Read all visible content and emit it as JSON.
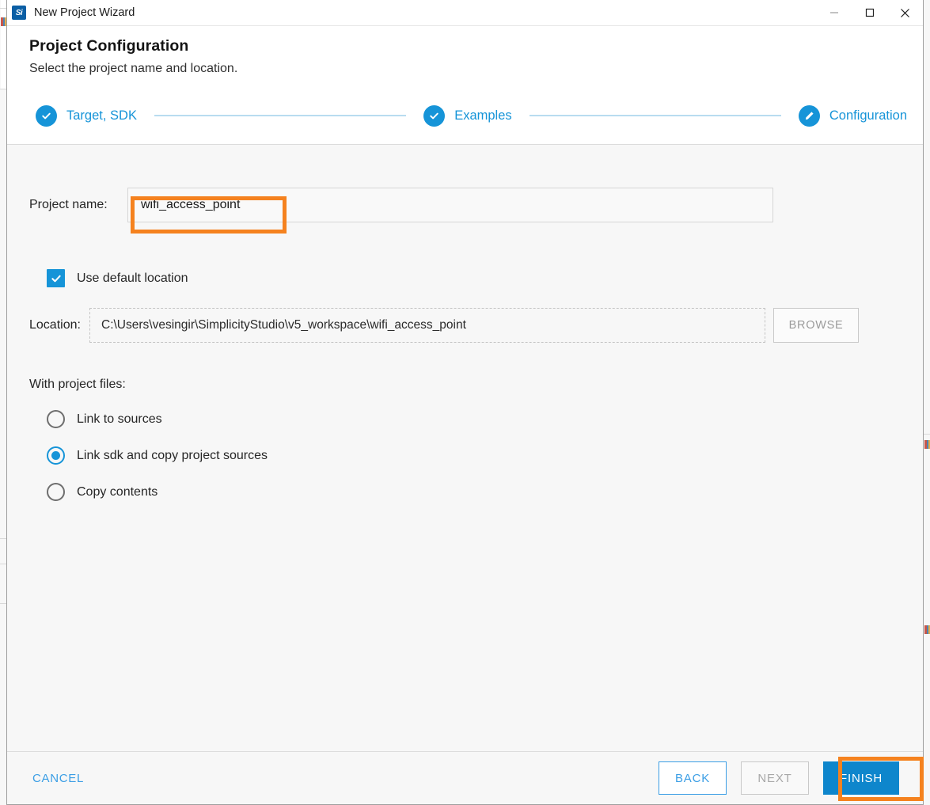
{
  "window": {
    "title": "New Project Wizard",
    "app_icon": "simplicity-studio-icon",
    "app_icon_text": "Si",
    "controls": {
      "minimize": "minimize-icon",
      "maximize": "maximize-icon",
      "close": "close-icon"
    }
  },
  "header": {
    "title": "Project Configuration",
    "subtitle": "Select the project name and location."
  },
  "stepper": {
    "steps": [
      {
        "label": "Target, SDK",
        "state": "completed",
        "icon": "check-icon"
      },
      {
        "label": "Examples",
        "state": "completed",
        "icon": "check-icon"
      },
      {
        "label": "Configuration",
        "state": "current",
        "icon": "pencil-icon"
      }
    ]
  },
  "form": {
    "project_name": {
      "label": "Project name:",
      "value": "wifi_access_point",
      "placeholder": ""
    },
    "use_default_location": {
      "label": "Use default location",
      "checked": true
    },
    "location": {
      "label": "Location:",
      "value": "C:\\Users\\vesingir\\SimplicityStudio\\v5_workspace\\wifi_access_point",
      "browse_label": "BROWSE",
      "browse_disabled": true
    },
    "project_files": {
      "label": "With project files:",
      "options": [
        {
          "label": "Link to sources",
          "selected": false
        },
        {
          "label": "Link sdk and copy project sources",
          "selected": true
        },
        {
          "label": "Copy contents",
          "selected": false
        }
      ]
    }
  },
  "footer": {
    "cancel_label": "CANCEL",
    "back_label": "BACK",
    "next_label": "NEXT",
    "next_disabled": true,
    "finish_label": "FINISH"
  },
  "annotations": {
    "color": "#f5821f",
    "boxes": [
      "project-name-field",
      "finish-button"
    ]
  },
  "colors": {
    "accent_blue": "#1694d8",
    "finish_blue": "#0e86cc",
    "link_blue": "#3b9ee5",
    "highlight_orange": "#f5821f",
    "content_bg": "#f7f7f7"
  }
}
